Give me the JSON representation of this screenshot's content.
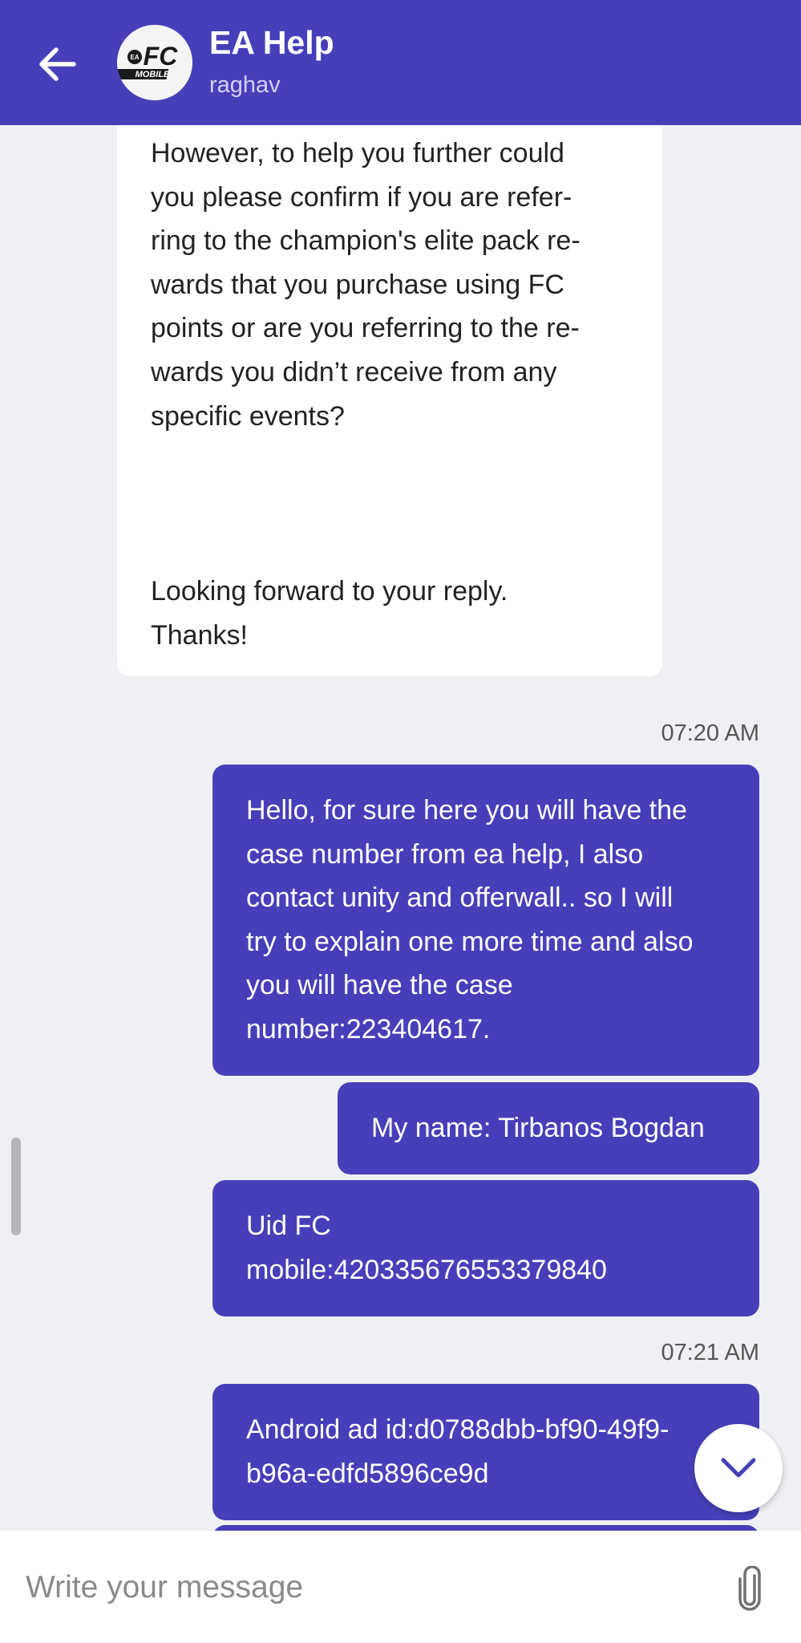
{
  "header": {
    "title": "EA Help",
    "subtitle": "raghav",
    "avatar_logo_text": "FC MOBILE"
  },
  "colors": {
    "accent": "#473fb9",
    "background": "#eff0f3",
    "bubble_in": "#ffffff"
  },
  "messages": {
    "incoming": {
      "para1_lines": [
        "However, to help you further could",
        "you please confirm if you are refer-",
        "ring to the champion's elite pack re-",
        "wards that you purchase using FC",
        "points or are you referring to the re-",
        "wards you didn’t receive from any",
        "specific events?"
      ],
      "para2_lines": [
        "Looking forward to your reply.",
        "Thanks!"
      ]
    },
    "time1": "07:20 AM",
    "out1_lines": [
      "Hello, for sure here you will have the",
      "case number from ea help, I also",
      "contact unity and offerwall.. so I will",
      "try to explain one more time and also",
      "you will have the case",
      "number:223404617."
    ],
    "out2": "My name: Tirbanos Bogdan",
    "out3_lines": [
      "Uid FC",
      "mobile:420335676553379840"
    ],
    "time2": "07:21 AM",
    "out4_lines": [
      "Android ad id:d0788dbb-bf90-49f9-",
      "b96a-edfd5896ce9d"
    ]
  },
  "composer": {
    "placeholder": "Write your message"
  },
  "icons": {
    "back": "arrow-left-icon",
    "scroll_down": "chevron-down-icon",
    "attach": "paperclip-icon"
  }
}
